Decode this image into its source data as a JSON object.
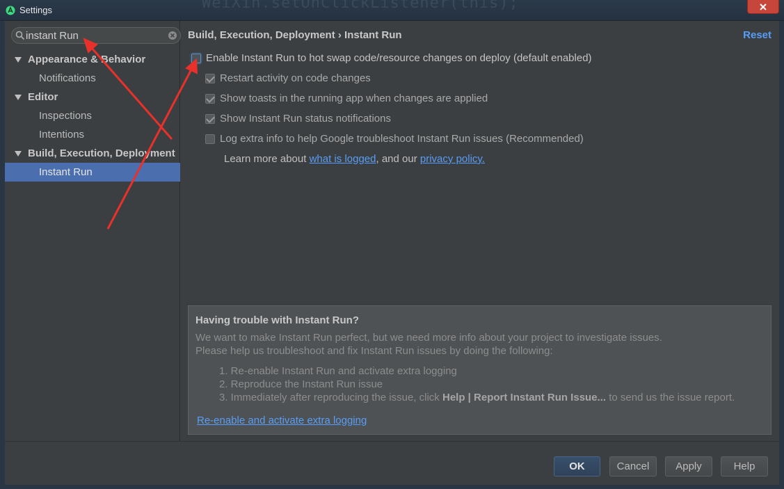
{
  "window": {
    "title": "Settings",
    "background_code": "WeiXin.setOnClickListener(this);"
  },
  "search": {
    "value": "instant Run"
  },
  "sidebar": {
    "items": [
      {
        "label": "Appearance & Behavior",
        "kind": "group"
      },
      {
        "label": "Notifications",
        "kind": "leaf"
      },
      {
        "label": "Editor",
        "kind": "group"
      },
      {
        "label": "Inspections",
        "kind": "leaf"
      },
      {
        "label": "Intentions",
        "kind": "leaf"
      },
      {
        "label": "Build, Execution, Deployment",
        "kind": "group"
      },
      {
        "label": "Instant Run",
        "kind": "leaf",
        "selected": true
      }
    ]
  },
  "main": {
    "breadcrumb": "Build, Execution, Deployment › Instant Run",
    "reset_label": "Reset",
    "options": [
      {
        "label": "Enable Instant Run to hot swap code/resource changes on deploy (default enabled)",
        "checked": false
      },
      {
        "label": "Restart activity on code changes",
        "checked": true
      },
      {
        "label": "Show toasts in the running app when changes are applied",
        "checked": true
      },
      {
        "label": "Show Instant Run status notifications",
        "checked": true
      },
      {
        "label": "Log extra info to help Google troubleshoot Instant Run issues (Recommended)",
        "checked": false
      }
    ],
    "learn_more": {
      "prefix": "Learn more about",
      "link1": "what is logged",
      "middle": ", and our",
      "link2": "privacy policy."
    },
    "trouble": {
      "title": "Having trouble with Instant Run?",
      "para1": "We want to make Instant Run perfect, but we need more info about your project to investigate issues.",
      "para2": "Please help us troubleshoot and fix Instant Run issues by doing the following:",
      "step1": "1. Re-enable Instant Run and activate extra logging",
      "step2": "2. Reproduce the Instant Run issue",
      "step3_prefix": "3. Immediately after reproducing the issue, click",
      "step3_bold": "Help | Report Instant Run Issue...",
      "step3_suffix": "to send us the issue report.",
      "link": "Re-enable and activate extra logging"
    }
  },
  "buttons": {
    "ok": "OK",
    "cancel": "Cancel",
    "apply": "Apply",
    "help": "Help"
  },
  "colors": {
    "accent": "#4b6eaf",
    "link": "#589df6",
    "annotation": "#e8312b"
  }
}
